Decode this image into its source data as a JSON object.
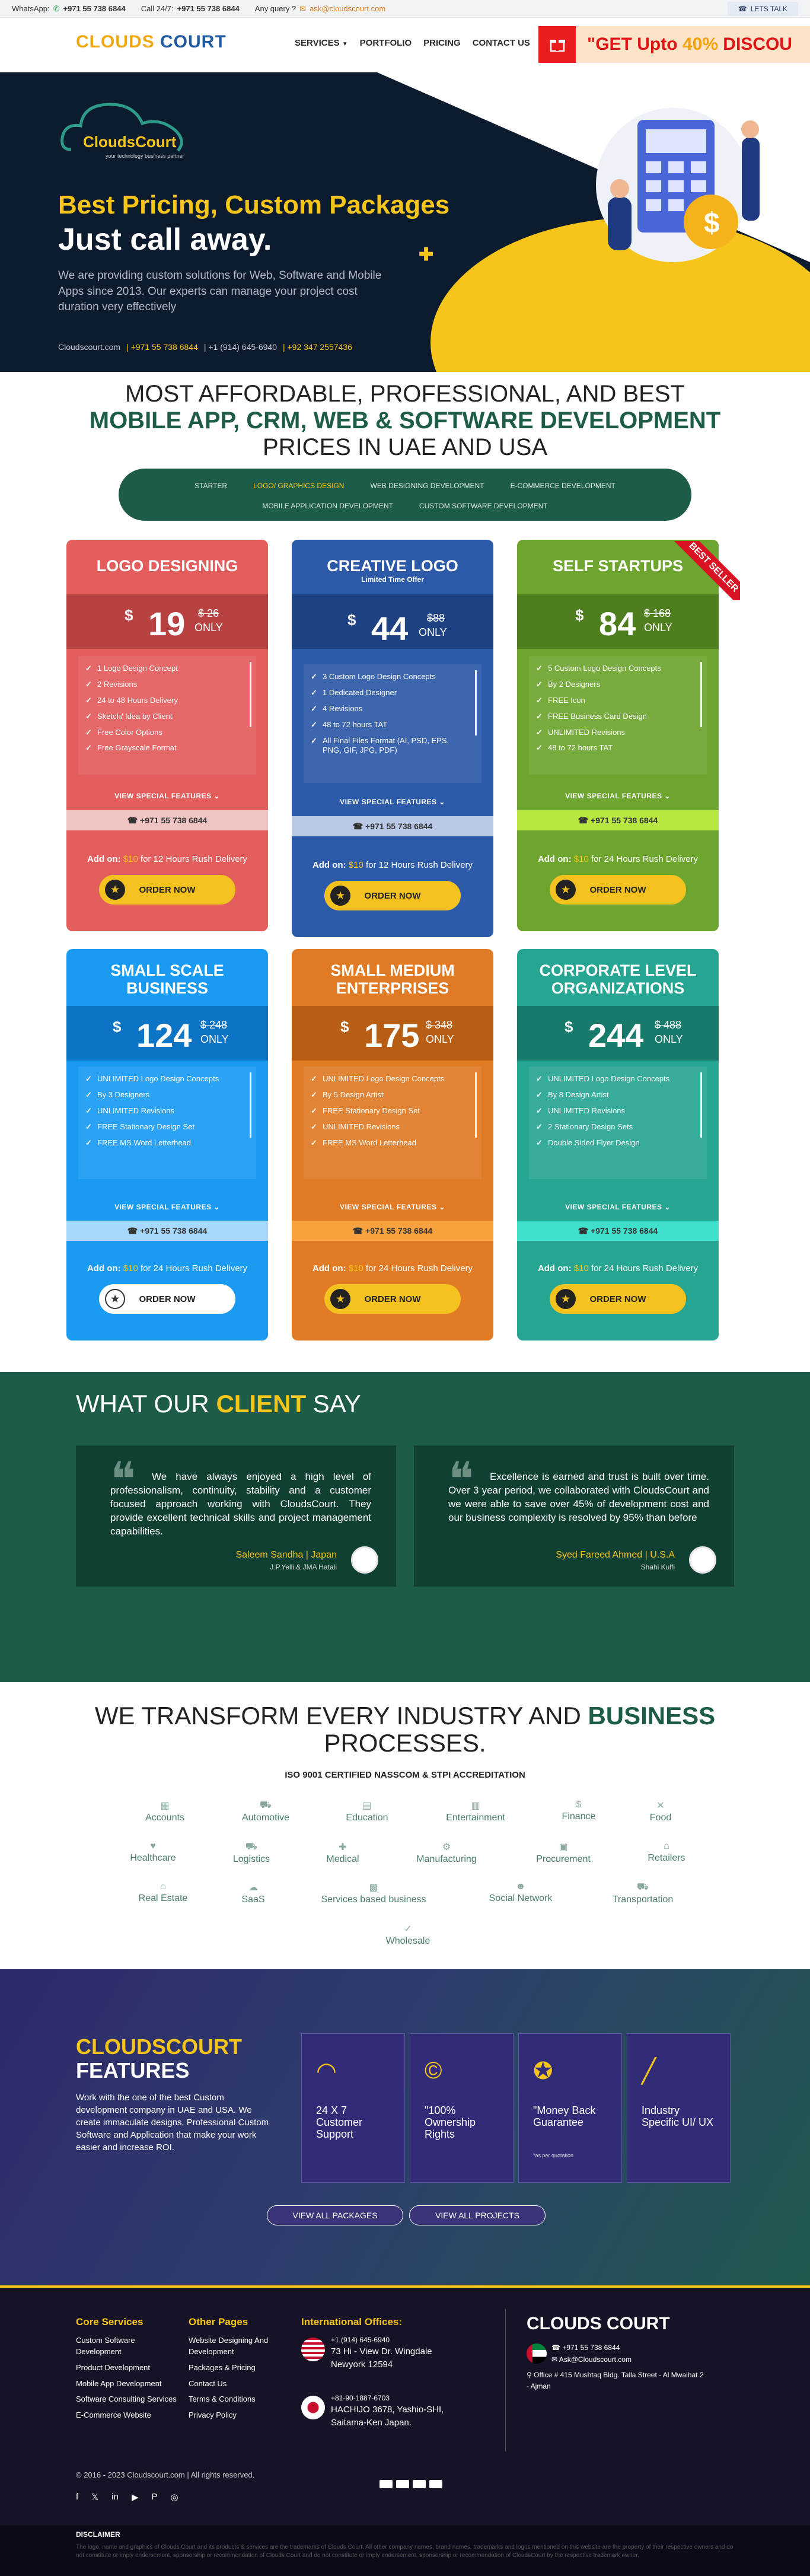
{
  "topbar": {
    "whatsapp_label": "WhatsApp:",
    "whatsapp": "+971 55 738 6844",
    "call_label": "Call 24/7:",
    "call": "+971 55 738 6844",
    "query_label": "Any query ?",
    "email": "ask@cloudscourt.com",
    "lets_talk": "LETS TALK"
  },
  "nav": {
    "logo_a": "CLOUDS",
    "logo_b": "COURT",
    "links": [
      "SERVICES",
      "PORTFOLIO",
      "PRICING",
      "CONTACT US"
    ],
    "promo": "\"GET Upto",
    "promo_pct": "40%",
    "promo_rest": "DISCOU"
  },
  "hero": {
    "logo_name": "CloudsCourt",
    "logo_tag": "your technology business partner",
    "title": "Best Pricing, Custom Packages",
    "subtitle": "Just call away.",
    "desc": "We are providing custom solutions for Web, Software and Mobile Apps since 2013. Our experts can manage your project cost duration very effectively",
    "site": "Cloudscourt.com",
    "c1": "| +971 55 738 6844",
    "c2": "| +1 (914) 645-6940",
    "c3": "| +92 347 2557436"
  },
  "heading": {
    "l1": "MOST AFFORDABLE, PROFESSIONAL, AND BEST",
    "l2": "MOBILE APP, CRM, WEB & SOFTWARE DEVELOPMENT",
    "l3": "PRICES IN UAE AND USA"
  },
  "tabs": {
    "r1": [
      "STARTER",
      "LOGO/ GRAPHICS DESIGN",
      "WEB DESIGNING DEVELOPMENT",
      "E-COMMERCE DEVELOPMENT"
    ],
    "r2": [
      "MOBILE APPLICATION DEVELOPMENT",
      "CUSTOM SOFTWARE DEVELOPMENT"
    ]
  },
  "cards": [
    {
      "title": "LOGO DESIGNING",
      "sub": "",
      "price": "19",
      "old": "$ 26",
      "features": [
        "1 Logo Design Concept",
        "2 Revisions",
        "24 to 48 Hours Delivery",
        "Sketch/ Idea by Client",
        "Free Color Options",
        "Free Grayscale Format"
      ],
      "phone": "+971 55 738 6844",
      "addon_price": "$10",
      "addon_rest": "for 12 Hours Rush Delivery",
      "order": "ORDER NOW"
    },
    {
      "title": "CREATIVE LOGO",
      "sub": "Limited Time Offer",
      "price": "44",
      "old": "$88",
      "features": [
        "3 Custom Logo Design Concepts",
        "1 Dedicated Designer",
        "4 Revisions",
        "48 to 72 hours TAT",
        "All Final Files Format (AI, PSD, EPS, PNG, GIF, JPG, PDF)"
      ],
      "phone": "+971 55 738 6844",
      "addon_price": "$10",
      "addon_rest": "for 12 Hours Rush Delivery",
      "order": "ORDER NOW"
    },
    {
      "title": "SELF STARTUPS",
      "sub": "",
      "price": "84",
      "old": "$ 168",
      "features": [
        "5 Custom Logo Design Concepts",
        "By 2 Designers",
        "FREE Icon",
        "FREE Business Card Design",
        "UNLIMITED Revisions",
        "48 to 72 hours TAT"
      ],
      "phone": "+971 55 738 6844",
      "addon_price": "$10",
      "addon_rest": "for 24 Hours Rush Delivery",
      "order": "ORDER NOW"
    },
    {
      "title": "SMALL SCALE BUSINESS",
      "sub": "",
      "price": "124",
      "old": "$ 248",
      "features": [
        "UNLIMITED Logo Design Concepts",
        "By 3 Designers",
        "UNLIMITED Revisions",
        "FREE Stationary Design Set",
        "FREE MS Word Letterhead"
      ],
      "phone": "+971 55 738 6844",
      "addon_price": "$10",
      "addon_rest": "for 24 Hours Rush Delivery",
      "order": "ORDER NOW"
    },
    {
      "title": "SMALL MEDIUM ENTERPRISES",
      "sub": "",
      "price": "175",
      "old": "$ 348",
      "features": [
        "UNLIMITED Logo Design Concepts",
        "By 5 Design Artist",
        "FREE Stationary Design Set",
        "UNLIMITED Revisions",
        "FREE MS Word Letterhead"
      ],
      "phone": "+971 55 738 6844",
      "addon_price": "$10",
      "addon_rest": "for 24 Hours Rush Delivery",
      "order": "ORDER NOW"
    },
    {
      "title": "CORPORATE LEVEL ORGANIZATIONS",
      "sub": "",
      "price": "244",
      "old": "$ 488",
      "features": [
        "UNLIMITED Logo Design Concepts",
        "By 8 Design Artist",
        "UNLIMITED Revisions",
        "2 Stationary Design Sets",
        "Double Sided Flyer Design"
      ],
      "phone": "+971 55 738 6844",
      "addon_price": "$10",
      "addon_rest": "for 24 Hours Rush Delivery",
      "order": "ORDER NOW"
    }
  ],
  "card_common": {
    "dollar": "$",
    "only": "ONLY",
    "special": "VIEW SPECIAL FEATURES",
    "addon": "Add on:",
    "ribbon": "BEST SELLER"
  },
  "colors": {
    "red": "#e35d5d",
    "blue": "#2d5aa8",
    "green": "#6ea52e",
    "sky": "#1a9bf2",
    "orange": "#e07a24",
    "teal": "#27a593"
  },
  "testimonials": {
    "title_a": "WHAT OUR",
    "title_b": "CLIENT",
    "title_c": "SAY",
    "items": [
      {
        "text": "We have always enjoyed a high level of professionalism, continuity, stability and a customer focused approach working with CloudsCourt. They provide excellent technical skills and project management capabilities.",
        "name": "Saleem Sandha | Japan",
        "company": "J.P.Yelli & JMA Hatali"
      },
      {
        "text": "Excellence is earned and trust is built over time. Over 3 year period, we collaborated with CloudsCourt and we were able to save over 45% of development cost and our business complexity is resolved by 95% than before",
        "name": "Syed Fareed Ahmed | U.S.A",
        "company": "Shahi Kulfi"
      }
    ]
  },
  "industries": {
    "title_a": "WE TRANSFORM EVERY INDUSTRY AND",
    "title_b": "BUSINESS",
    "title_c": "PROCESSES.",
    "iso": "ISO 9001 CERTIFIED NASSCOM & STPI ACCREDITATION",
    "row1": [
      "Accounts",
      "Automotive",
      "Education",
      "Entertainment",
      "Finance",
      "Food"
    ],
    "row2": [
      "Healthcare",
      "Logistics",
      "Medical",
      "Manufacturing",
      "Procurement",
      "Retailers"
    ],
    "row3": [
      "Real Estate",
      "SaaS",
      "Services based business",
      "Social Network",
      "Transportation"
    ],
    "row4": [
      "Wholesale"
    ]
  },
  "features": {
    "title": "CLOUDSCOURT",
    "title2": "FEATURES",
    "desc": "Work with the one of the best Custom development company in UAE and USA. We create immaculate designs, Professional Custom Software and Application that make your work easier and increase ROI.",
    "boxes": [
      {
        "text": "24 X 7 Customer Support",
        "small": ""
      },
      {
        "text": "\"100% Ownership Rights",
        "small": ""
      },
      {
        "text": "\"Money Back Guarantee",
        "small": "*as per quotation"
      },
      {
        "text": "Industry Specific UI/ UX",
        "small": ""
      }
    ],
    "btn1": "VIEW ALL PACKAGES",
    "btn2": "VIEW ALL PROJECTS"
  },
  "footer": {
    "core_title": "Core Services",
    "core": [
      "Custom Software Development",
      "Product Development",
      "Mobile App Development",
      "Software Consulting Services",
      "E-Commerce Website"
    ],
    "other_title": "Other Pages",
    "other": [
      "Website Designing And Development",
      "Packages & Pricing",
      "Contact Us",
      "Terms & Conditions",
      "Privacy Policy"
    ],
    "intl_title": "International Offices:",
    "us_phone": "+1 (914) 645-6940",
    "us_addr": "73 Hi - View Dr. Wingdale Newyork 12594",
    "jp_phone": "+81-90-1887-6703",
    "jp_addr": "HACHIJO 3678, Yashio-SHI, Saitama-Ken Japan.",
    "brand": "CLOUDS COURT",
    "uae_phone": "+971 55 738 6844",
    "uae_mail": "Ask@Cloudscourt.com",
    "uae_addr": "Office # 415 Mushtaq Bldg. Talla Street - Al Mwaihat 2 - Ajman",
    "copyright": "© 2016 - 2023 Cloudscourt.com | All rights reserved.",
    "disclaimer_title": "DISCLAIMER",
    "disclaimer": "The logo, name and graphics of Clouds Court and its products & services are the trademarks of Clouds Court. All other company names, brand names, trademarks and logos mentioned on this website are the property of their respective owners and do not constitute or imply endorsement, sponsorship or recommendation of Clouds Court and do not constitute or imply endorsement, sponsorship or recommendation of CloudsCourt by the respective trademark owner."
  }
}
